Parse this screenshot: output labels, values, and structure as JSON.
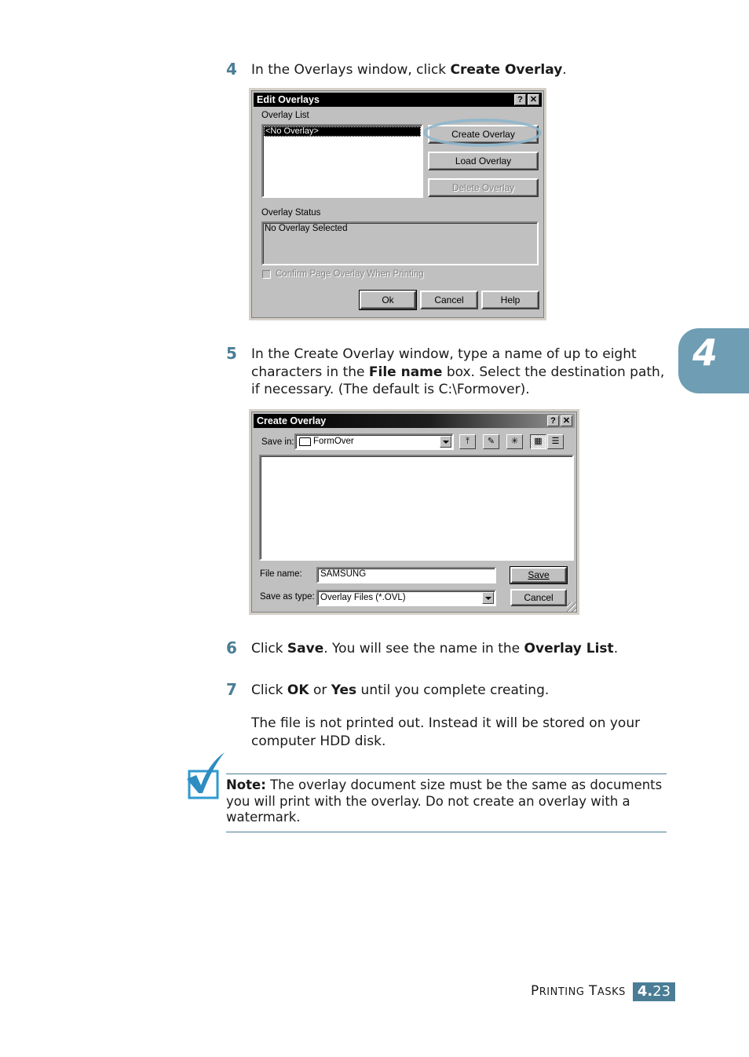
{
  "steps": [
    {
      "number": "4",
      "text_parts": [
        {
          "t": "In the Overlays window, click ",
          "b": false
        },
        {
          "t": "Create Overlay",
          "b": true
        },
        {
          "t": ".",
          "b": false
        }
      ]
    },
    {
      "number": "5",
      "text_parts": [
        {
          "t": "In the Create Overlay window, type a name of up to eight characters in the ",
          "b": false
        },
        {
          "t": "File name",
          "b": true
        },
        {
          "t": " box. Select the destination path, if necessary. (The default is C:\\Formover).",
          "b": false
        }
      ]
    },
    {
      "number": "6",
      "text_parts": [
        {
          "t": "Click ",
          "b": false
        },
        {
          "t": "Save",
          "b": true
        },
        {
          "t": ". You will see the name in the ",
          "b": false
        },
        {
          "t": "Overlay List",
          "b": true
        },
        {
          "t": ".",
          "b": false
        }
      ]
    },
    {
      "number": "7",
      "text_parts": [
        {
          "t": "Click ",
          "b": false
        },
        {
          "t": "OK",
          "b": true
        },
        {
          "t": " or ",
          "b": false
        },
        {
          "t": "Yes",
          "b": true
        },
        {
          "t": " until you complete creating.",
          "b": false
        }
      ]
    }
  ],
  "step7_followup": "The file is not printed out. Instead it will be stored on your computer HDD disk.",
  "edit_overlays": {
    "title": "Edit Overlays",
    "help_btn": "?",
    "close_btn": "✕",
    "overlay_list_label": "Overlay List",
    "overlay_list_items": [
      "<No Overlay>"
    ],
    "create_overlay": "Create Overlay",
    "load_overlay": "Load Overlay",
    "delete_overlay": "Delete Overlay",
    "overlay_status_label": "Overlay Status",
    "overlay_status_text": "No Overlay Selected",
    "confirm_checkbox_label": "Confirm Page Overlay When Printing",
    "ok": "Ok",
    "cancel": "Cancel",
    "help": "Help"
  },
  "create_overlay": {
    "title": "Create Overlay",
    "help_btn": "?",
    "close_btn": "✕",
    "save_in_label": "Save in:",
    "save_in_value": "FormOver",
    "file_name_label": "File name:",
    "file_name_value": "SAMSUNG",
    "save_as_type_label": "Save as type:",
    "save_as_type_value": "Overlay Files (*.OVL)",
    "save": "Save",
    "cancel": "Cancel"
  },
  "chapter_tab": "4",
  "note": {
    "label": "Note:",
    "text": " The overlay document size must be the same as documents you will print with the overlay. Do not create an overlay with a watermark."
  },
  "footer": {
    "section_title": "Printing Tasks",
    "page_chapter": "4.",
    "page_number": "23"
  },
  "colors": {
    "accent": "#4a7d95",
    "tab": "#6f9db3",
    "dialog_bg": "#c0c0c0"
  }
}
